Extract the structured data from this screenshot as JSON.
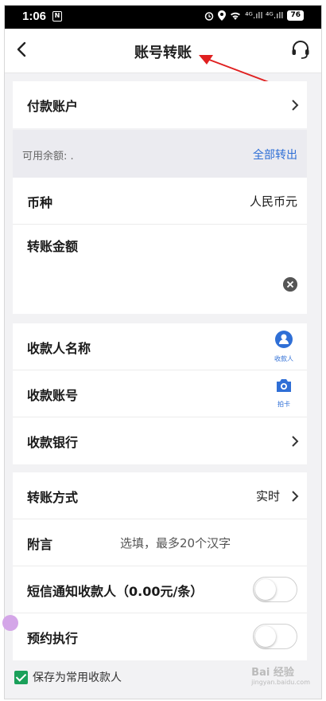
{
  "status": {
    "time": "1:06",
    "nfc": "N",
    "signal": "⁴ᴳ.ıll ⁴ᴳ.ıll",
    "battery": "76"
  },
  "nav": {
    "title": "账号转账"
  },
  "payer": {
    "label": "付款账户"
  },
  "balance": {
    "label": "可用余额: .",
    "action": "全部转出"
  },
  "currency": {
    "label": "币种",
    "value": "人民币元"
  },
  "amount": {
    "label": "转账金额"
  },
  "payee": {
    "name_label": "收款人名称",
    "name_icon_caption": "收款人",
    "account_label": "收款账号",
    "account_icon_caption": "拍卡",
    "bank_label": "收款银行"
  },
  "method": {
    "label": "转账方式",
    "value": "实时"
  },
  "remark": {
    "label": "附言",
    "placeholder": "选填，最多20个汉字"
  },
  "sms": {
    "label": "短信通知收款人（0.00元/条）",
    "enabled": false
  },
  "schedule": {
    "label": "预约执行",
    "enabled": false
  },
  "save_payee": {
    "label": "保存为常用收款人",
    "checked": true
  },
  "watermark": {
    "text": "Bai 经验",
    "sub": "jingyan.baidu.com"
  },
  "colors": {
    "accent": "#2f6fd6",
    "check": "#1aa05a",
    "annotation": "#e02020"
  }
}
